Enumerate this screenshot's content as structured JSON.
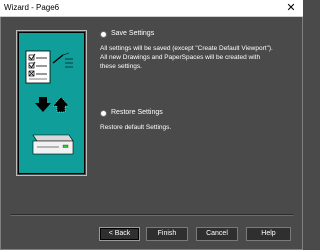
{
  "window": {
    "title": "Wizard - Page6",
    "close_glyph": "✕"
  },
  "options": {
    "save": {
      "label": "Save Settings",
      "selected": false,
      "description_line1": "All settings will be saved (except \"Create Default Viewport\").",
      "description_line2": "All new Drawings and PaperSpaces will be created with",
      "description_line3": "these settings."
    },
    "restore": {
      "label": "Restore Settings",
      "selected": false,
      "description": "Restore default Settings."
    }
  },
  "buttons": {
    "back": "< Back",
    "finish": "Finish",
    "cancel": "Cancel",
    "help": "Help"
  },
  "colors": {
    "illustration_bg": "#0f9e9a",
    "window_bg": "#4a4a4a"
  }
}
